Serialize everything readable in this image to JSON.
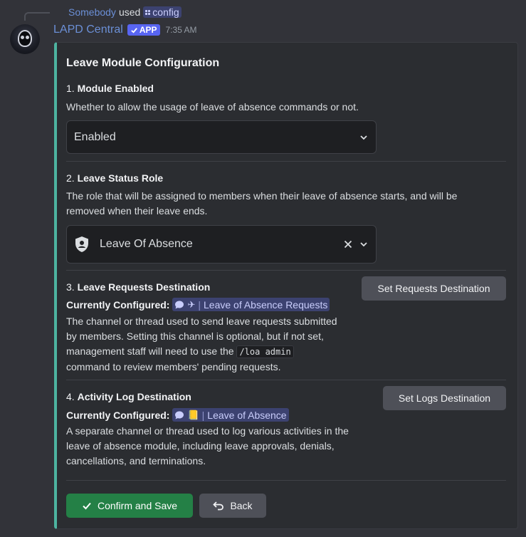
{
  "reply": {
    "user": "Somebody",
    "used": "used",
    "command": "config"
  },
  "author": {
    "name": "LAPD Central",
    "badge": "APP",
    "time": "7:35 AM"
  },
  "embed": {
    "title": "Leave Module Configuration",
    "accent_color": "#4db3a0",
    "sections": [
      {
        "number": "1.",
        "heading": "Module Enabled",
        "description": "Whether to allow the usage of leave of absence commands or not.",
        "select_value": "Enabled"
      },
      {
        "number": "2.",
        "heading": "Leave Status Role",
        "description_line1": "The role that will be assigned to members when their leave of absence starts, and will be",
        "description_line2": "removed when their leave ends.",
        "select_value": "Leave Of Absence"
      },
      {
        "number": "3.",
        "heading": "Leave Requests Destination",
        "configured_label": "Currently Configured:",
        "channel_name": "Leave of Absence Requests",
        "channel_emoji": "✈",
        "description_line1": "The channel or thread used to send leave requests submitted",
        "description_line2": "by members. Setting this channel is optional, but if not set,",
        "description_line3a": "management staff will need to use the",
        "description_code": "/loa admin",
        "description_line4": "command to review members' pending requests.",
        "button": "Set Requests Destination"
      },
      {
        "number": "4.",
        "heading": "Activity Log Destination",
        "configured_label": "Currently Configured:",
        "channel_name": "Leave of Absence",
        "channel_emoji": "📒",
        "description_line1": "A separate channel or thread used to log various activities in the",
        "description_line2": "leave of absence module, including leave approvals, denials,",
        "description_line3": "cancellations, and terminations.",
        "button": "Set Logs Destination"
      }
    ],
    "confirm_button": "Confirm and Save",
    "back_button": "Back"
  }
}
